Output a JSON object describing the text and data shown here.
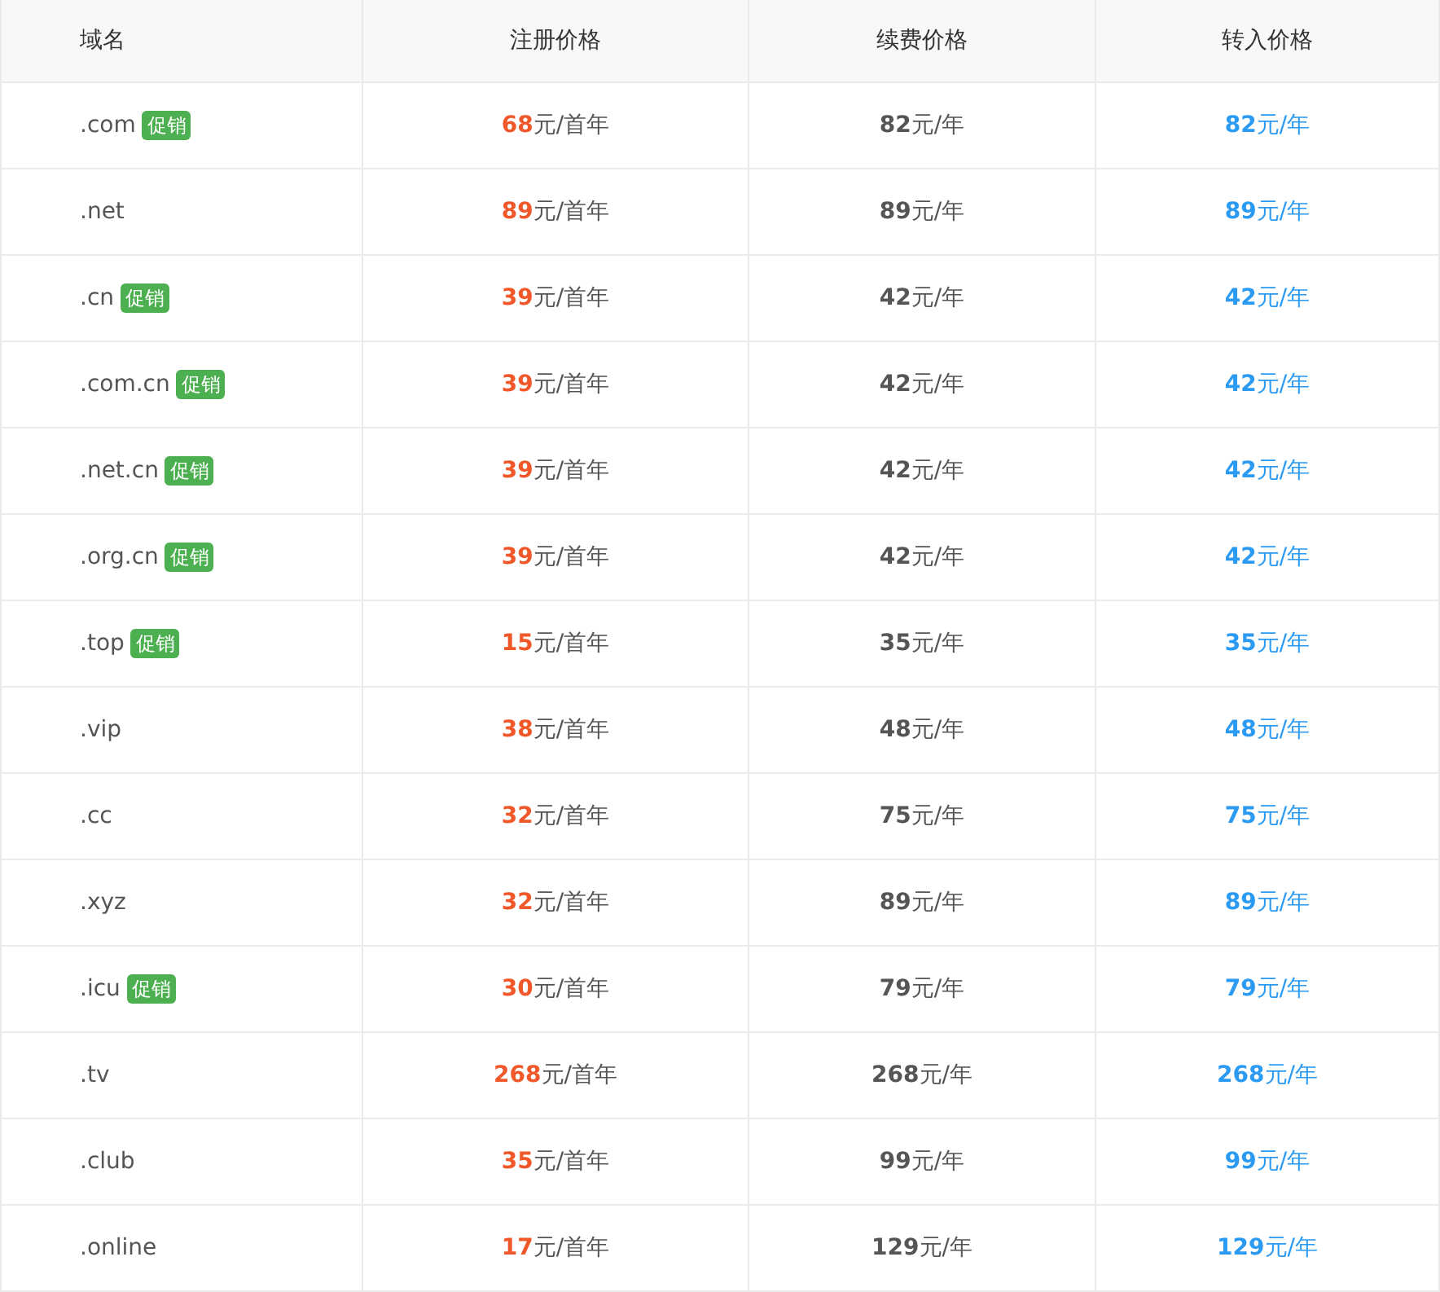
{
  "table": {
    "columns": [
      {
        "label": "域名",
        "kind": "domain"
      },
      {
        "label": "注册价格",
        "kind": "register"
      },
      {
        "label": "续费价格",
        "kind": "renew"
      },
      {
        "label": "转入价格",
        "kind": "transfer"
      }
    ],
    "rows": [
      {
        "domain": ".com",
        "badge": "促销",
        "register": "**68**元/首年",
        "renew": "**82**元/年",
        "transfer": "**82**元/年"
      },
      {
        "domain": ".net",
        "register": "**89**元/首年",
        "renew": "**89**元/年",
        "transfer": "**89**元/年"
      },
      {
        "domain": ".cn",
        "badge": "促销",
        "register": "**39**元/首年",
        "renew": "**42**元/年",
        "transfer": "**42**元/年"
      },
      {
        "domain": ".com.cn",
        "badge": "促销",
        "register": "**39**元/首年",
        "renew": "**42**元/年",
        "transfer": "**42**元/年"
      },
      {
        "domain": ".net.cn",
        "badge": "促销",
        "register": "**39**元/首年",
        "renew": "**42**元/年",
        "transfer": "**42**元/年"
      },
      {
        "domain": ".org.cn",
        "badge": "促销",
        "register": "**39**元/首年",
        "renew": "**42**元/年",
        "transfer": "**42**元/年"
      },
      {
        "domain": ".top",
        "badge": "促销",
        "register": "**15**元/首年",
        "renew": "**35**元/年",
        "transfer": "**35**元/年"
      },
      {
        "domain": ".vip",
        "register": "**38**元/首年",
        "renew": "**48**元/年",
        "transfer": "**48**元/年"
      },
      {
        "domain": ".cc",
        "register": "**32**元/首年",
        "renew": "**75**元/年",
        "transfer": "**75**元/年"
      },
      {
        "domain": ".xyz",
        "register": "**32**元/首年",
        "renew": "**89**元/年",
        "transfer": "**89**元/年"
      },
      {
        "domain": ".icu",
        "badge": "促销",
        "register": "**30**元/首年",
        "renew": "**79**元/年",
        "transfer": "**79**元/年"
      },
      {
        "domain": ".tv",
        "register": "**268**元/首年",
        "renew": "**268**元/年",
        "transfer": "**268**元/年"
      },
      {
        "domain": ".club",
        "register": "**35**元/首年",
        "renew": "**99**元/年",
        "transfer": "**99**元/年"
      },
      {
        "domain": ".online",
        "register": "**17**元/首年",
        "renew": "**129**元/年",
        "transfer": "**129**元/年"
      }
    ]
  }
}
